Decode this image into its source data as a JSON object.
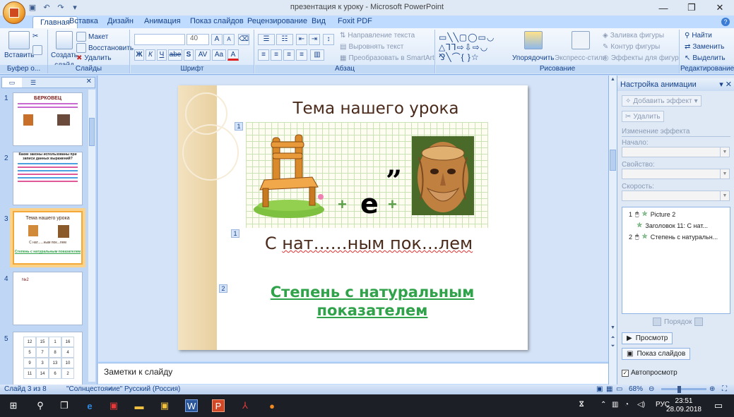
{
  "window": {
    "title": "презентация к уроку - Microsoft PowerPoint",
    "minimize": "—",
    "maximize": "❐",
    "close": "✕"
  },
  "ribbon_tabs": [
    "Главная",
    "Вставка",
    "Дизайн",
    "Анимация",
    "Показ слайдов",
    "Рецензирование",
    "Вид",
    "Foxit PDF"
  ],
  "ribbon": {
    "clipboard": {
      "paste": "Вставить",
      "label": "Буфер о...",
      "cut_icon": "scissors-icon",
      "copy_icon": "copy-icon"
    },
    "slides": {
      "new_slide_1": "Создать",
      "new_slide_2": "слайд",
      "layout": "Макет",
      "reset": "Восстановить",
      "delete": "Удалить",
      "label": "Слайды"
    },
    "font": {
      "size": "40",
      "grow": "A",
      "shrink": "A",
      "bold": "Ж",
      "italic": "К",
      "underline": "Ч",
      "strike": "abe",
      "shadow": "S",
      "spacing": "AV",
      "case": "Aa",
      "color": "A",
      "label": "Шрифт"
    },
    "paragraph": {
      "text_direction": "Направление текста",
      "align_text": "Выровнять текст",
      "smartart": "Преобразовать в SmartArt",
      "label": "Абзац"
    },
    "drawing": {
      "arrange": "Упорядочить",
      "quick_styles": "Экспресс-стили",
      "fill": "Заливка фигуры",
      "outline": "Контур фигуры",
      "effects": "Эффекты для фигур",
      "label": "Рисование"
    },
    "editing": {
      "find": "Найти",
      "replace": "Заменить",
      "select": "Выделить",
      "label": "Редактирование"
    }
  },
  "left_panel": {
    "thumbnails": [
      {
        "num": "1",
        "title": "БЕРКОВЕЦ"
      },
      {
        "num": "2",
        "title": "Какие законы использованы при записи данных выражений?"
      },
      {
        "num": "3",
        "title": "Тема нашего урока",
        "line": "С нат......ным пок...лем",
        "answer": "Степень с натуральным показателем"
      },
      {
        "num": "4",
        "title": "№2"
      },
      {
        "num": "5",
        "grid": [
          "12",
          "15",
          "1",
          "16",
          "5",
          "7",
          "8",
          "4",
          "9",
          "3",
          "13",
          "10",
          "11",
          "14",
          "6",
          "2"
        ]
      }
    ]
  },
  "slide": {
    "title": "Тема нашего урока",
    "rebus_quote": "”",
    "rebus_letter": "е",
    "plus": "+",
    "rebus_line_prefix": "С ",
    "rebus_line_main": "нат……ным пок…лем",
    "answer_line1": "Степень с натуральным",
    "answer_line2": "показателем",
    "tags": [
      "1",
      "1",
      "2"
    ]
  },
  "notes": {
    "placeholder": "Заметки к слайду"
  },
  "animation_pane": {
    "title": "Настройка анимации",
    "add_effect": "Добавить эффект",
    "remove": "Удалить",
    "modify": "Изменение эффекта",
    "start": "Начало:",
    "property": "Свойство:",
    "speed": "Скорость:",
    "items": [
      {
        "num": "1",
        "text": "Picture 2"
      },
      {
        "num": "",
        "text": "Заголовок 11: С нат..."
      },
      {
        "num": "2",
        "text": "Степень с натуральн..."
      }
    ],
    "reorder": "Порядок",
    "play": "Просмотр",
    "slideshow": "Показ слайдов",
    "autopreview": "Автопросмотр"
  },
  "status": {
    "slide_info": "Слайд 3 из 8",
    "theme": "\"Солнцестояние\"",
    "language": "Русский (Россия)",
    "zoom": "68%"
  },
  "taskbar": {
    "tray_lang": "РУС",
    "time": "23:51",
    "date": "28.09.2018"
  }
}
